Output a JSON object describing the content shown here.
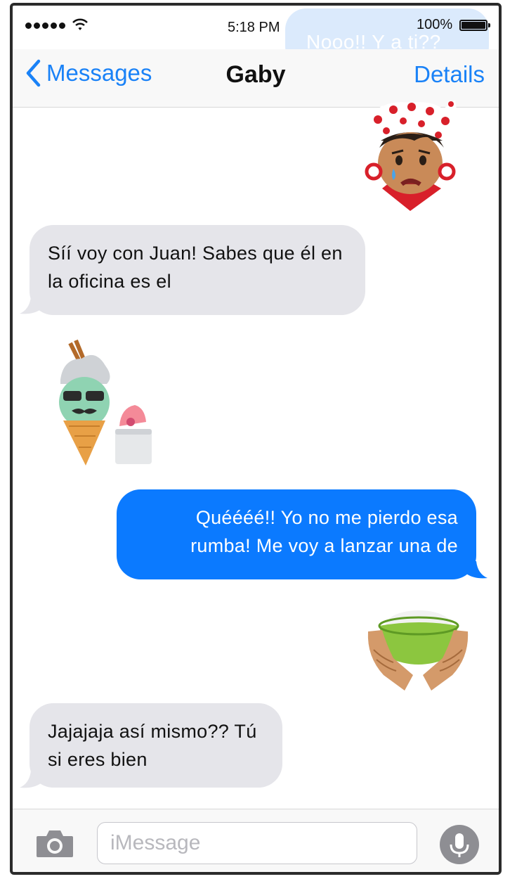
{
  "status_bar": {
    "time": "5:18 PM",
    "battery": "100%"
  },
  "nav": {
    "back_label": "Messages",
    "title": "Gaby",
    "details_label": "Details"
  },
  "ghost_message": "Nooo!! Y a ti??",
  "messages": [
    {
      "from": "them",
      "text": "Síí voy con Juan! Sabes que él en la oficina es el"
    },
    {
      "from": "me",
      "text": "Quéééé!! Yo no me pierdo esa rumba! Me voy a lanzar una de"
    },
    {
      "from": "them",
      "text": "Jajajaja así mismo?? Tú si eres bien"
    }
  ],
  "stickers": [
    "crying-woman-sticker",
    "ice-cream-couple-sticker",
    "rice-bowl-sticker"
  ],
  "input": {
    "placeholder": "iMessage"
  },
  "colors": {
    "accent": "#1a82f7",
    "sent_bubble": "#0b7aff",
    "received_bubble": "#e5e5ea"
  }
}
